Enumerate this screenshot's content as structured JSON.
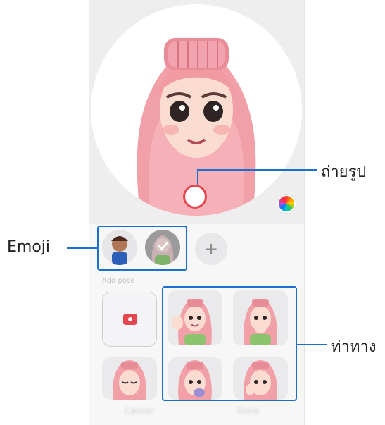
{
  "labels": {
    "capture": "ถ่ายรูป",
    "emoji": "Emoji",
    "poses": "ท่าทาง"
  },
  "controls": {
    "add_symbol": "+",
    "section_title": "Add pose",
    "cancel": "Cancel",
    "done": "Done"
  },
  "colors": {
    "accent": "#e5464f",
    "callout": "#1a6fd1",
    "hair": "#f2a0a8"
  }
}
